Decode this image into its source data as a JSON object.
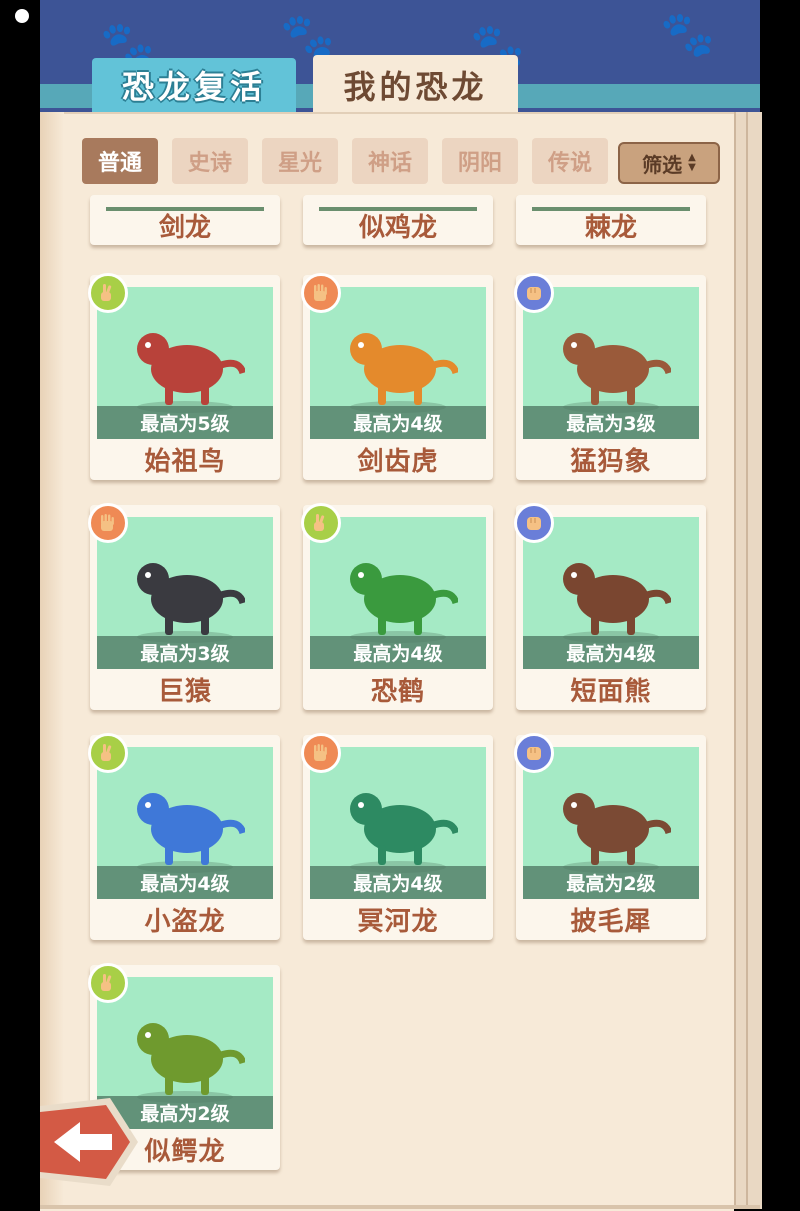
{
  "tabs": {
    "revive": "恐龙复活",
    "mine": "我的恐龙"
  },
  "filters": [
    "普通",
    "史诗",
    "星光",
    "神话",
    "阴阳",
    "传说"
  ],
  "active_filter": "普通",
  "sort_label": "筛选",
  "top_row": [
    "剑龙",
    "似鸡龙",
    "棘龙"
  ],
  "cards": [
    {
      "name": "始祖鸟",
      "level": "最高为5级",
      "hand": "scissors",
      "icon": "archaeopteryx-icon",
      "color": "#b8423a"
    },
    {
      "name": "剑齿虎",
      "level": "最高为4级",
      "hand": "paper",
      "icon": "sabertooth-icon",
      "color": "#e48a2c"
    },
    {
      "name": "猛犸象",
      "level": "最高为3级",
      "hand": "rock",
      "icon": "mammoth-icon",
      "color": "#9a5a3a"
    },
    {
      "name": "巨猿",
      "level": "最高为3级",
      "hand": "paper",
      "icon": "gorilla-icon",
      "color": "#3a3a40"
    },
    {
      "name": "恐鹤",
      "level": "最高为4级",
      "hand": "scissors",
      "icon": "terror-bird-icon",
      "color": "#3a9a3e"
    },
    {
      "name": "短面熊",
      "level": "最高为4级",
      "hand": "rock",
      "icon": "short-faced-bear-icon",
      "color": "#7a4630"
    },
    {
      "name": "小盗龙",
      "level": "最高为4级",
      "hand": "scissors",
      "icon": "microraptor-icon",
      "color": "#3f78d8"
    },
    {
      "name": "冥河龙",
      "level": "最高为4级",
      "hand": "paper",
      "icon": "stygimoloch-icon",
      "color": "#2d8a62"
    },
    {
      "name": "披毛犀",
      "level": "最高为2级",
      "hand": "rock",
      "icon": "woolly-rhino-icon",
      "color": "#7b4a34"
    },
    {
      "name": "似鳄龙",
      "level": "最高为2级",
      "hand": "scissors",
      "icon": "suchomimus-icon",
      "color": "#6f9a2e"
    }
  ]
}
